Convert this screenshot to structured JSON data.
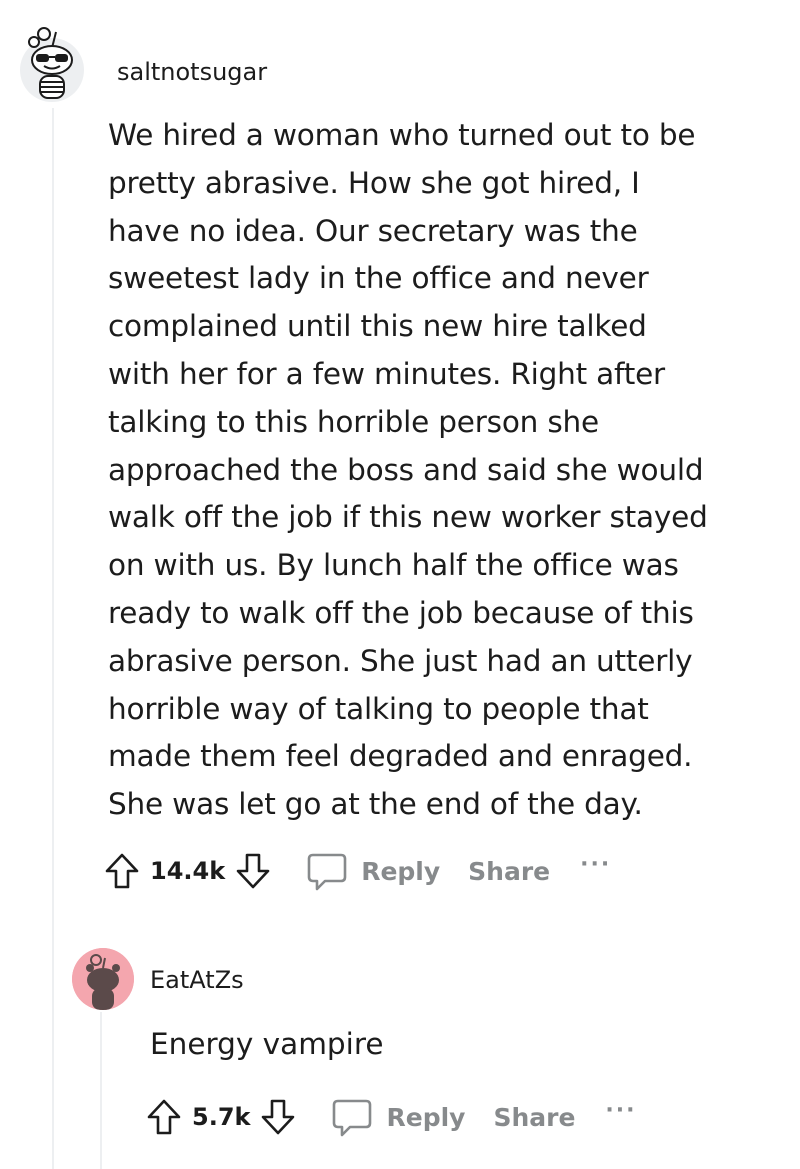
{
  "comment": {
    "username": "saltnotsugar",
    "body_lines": [
      "We hired a woman who turned out to be",
      "pretty abrasive. How she got hired, I",
      "have no idea. Our secretary was the",
      "sweetest lady in the office and never",
      "complained until this new hire talked",
      "with her for a few minutes. Right after",
      "talking to this horrible person she",
      "approached the boss and said she would",
      "walk off the job if this new worker stayed",
      "on with us. By lunch half the office was",
      "ready to walk off the job because of this",
      "abrasive person. She just had an utterly",
      "horrible way of talking to people that",
      "made them feel degraded and enraged.",
      "She was let go at the end of the day."
    ],
    "score": "14.4k",
    "reply_label": "Reply",
    "share_label": "Share",
    "more_label": "···"
  },
  "reply": {
    "username": "EatAtZs",
    "body": "Energy vampire",
    "score": "5.7k",
    "reply_label": "Reply",
    "share_label": "Share",
    "more_label": "···"
  },
  "colors": {
    "text": "#1c1c1c",
    "muted": "#878a8c",
    "thread_line": "#edeff1",
    "reply_avatar_bg": "#f4a6ae"
  },
  "icons": {
    "upvote": "arrow-up-outline",
    "downvote": "arrow-down-outline",
    "reply": "speech-bubble-outline",
    "avatar_main": "snoo-sunglasses",
    "avatar_reply": "snoo-silhouette"
  }
}
